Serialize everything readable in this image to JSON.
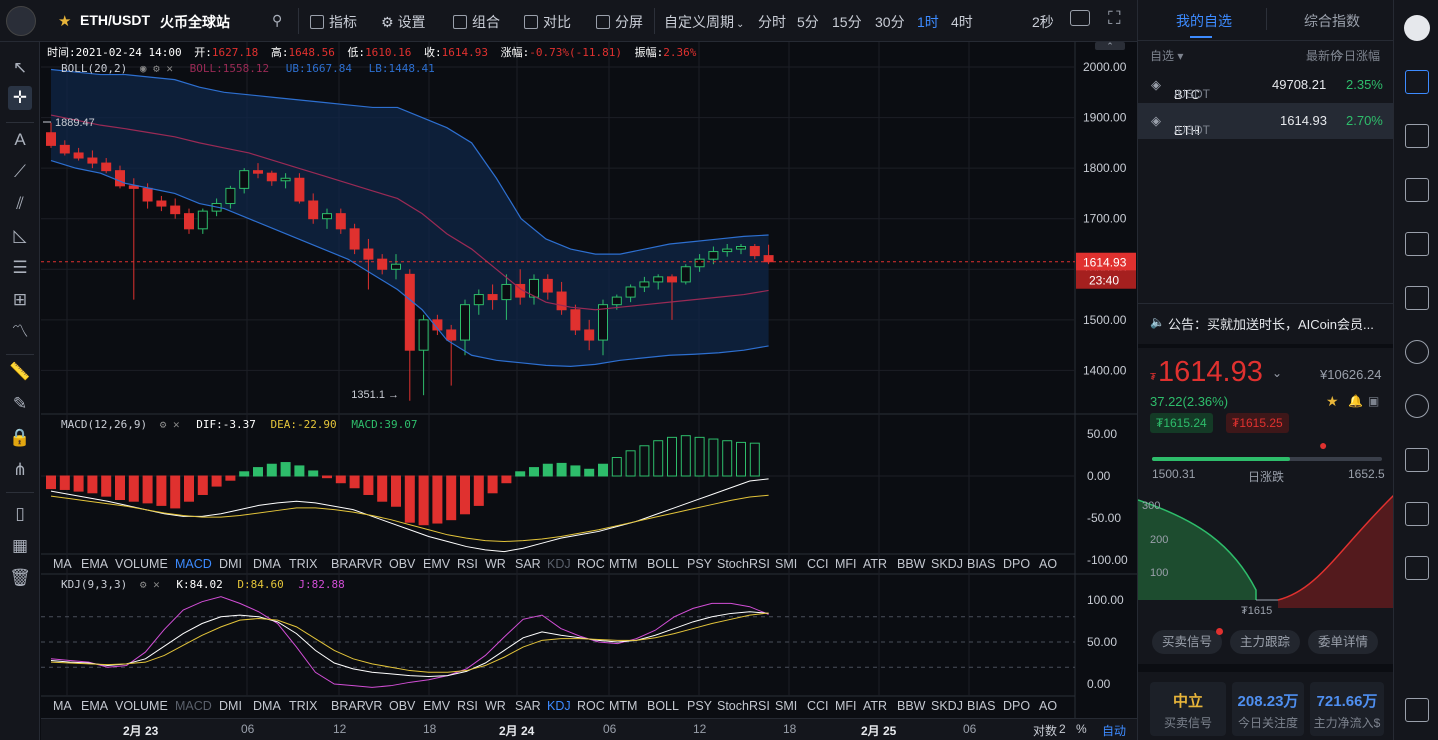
{
  "toolbar": {
    "pair": "ETH/USDT",
    "exchange": "火币全球站",
    "indicators": "指标",
    "settings": "设置",
    "combine": "组合",
    "compare": "对比",
    "split": "分屏",
    "custom_period": "自定义周期",
    "periods": [
      "分时",
      "5分",
      "15分",
      "30分",
      "1时",
      "4时"
    ],
    "active_period": "1时",
    "refresh": "2秒"
  },
  "ohlc": {
    "time_label": "时间:",
    "time": "2021-02-24 14:00",
    "open_label": "开:",
    "open": "1627.18",
    "high_label": "高:",
    "high": "1648.56",
    "low_label": "低:",
    "low": "1610.16",
    "close_label": "收:",
    "close": "1614.93",
    "change_label": "涨幅:",
    "change": "-0.73%(-11.81)",
    "amp_label": "振幅:",
    "amp": "2.36%"
  },
  "boll": {
    "name": "BOLL(20,2)",
    "mid": "BOLL:1558.12",
    "ub": "UB:1667.84",
    "lb": "LB:1448.41"
  },
  "macd": {
    "name": "MACD(12,26,9)",
    "dif": "DIF:-3.37",
    "dea": "DEA:-22.90",
    "macd": "MACD:39.07"
  },
  "kdj": {
    "name": "KDJ(9,3,3)",
    "k": "K:84.02",
    "d": "D:84.60",
    "j": "J:82.88"
  },
  "price_axis": [
    "2000.00",
    "1900.00",
    "1800.00",
    "1700.00",
    "1600.00",
    "1500.00",
    "1400.00"
  ],
  "current_price_tag": "1614.93",
  "countdown_tag": "23:40",
  "high_marker": "1889.47",
  "low_marker": "1351.1",
  "macd_axis": [
    "50.00",
    "0.00",
    "-50.00",
    "-100.00"
  ],
  "kdj_axis": [
    "100.00",
    "50.00",
    "0.00"
  ],
  "indicator_tabs": [
    "MA",
    "EMA",
    "VOLUME",
    "MACD",
    "DMI",
    "DMA",
    "TRIX",
    "BRAR",
    "VR",
    "OBV",
    "EMV",
    "RSI",
    "WR",
    "SAR",
    "KDJ",
    "ROC",
    "MTM",
    "BOLL",
    "PSY",
    "StochRSI",
    "SMI",
    "CCI",
    "MFI",
    "ATR",
    "BBW",
    "SKDJ",
    "BIAS",
    "DPO",
    "AO"
  ],
  "time_axis": [
    "2月 23",
    "06",
    "12",
    "18",
    "2月 24",
    "06",
    "12",
    "18",
    "2月 25",
    "06"
  ],
  "bottom": {
    "log": "对数",
    "count": "2",
    "percent": "%",
    "auto": "自动"
  },
  "right": {
    "tab_watchlist": "我的自选",
    "tab_index": "综合指数",
    "col_watch": "自选",
    "col_price": "最新价",
    "col_change": "今日涨幅",
    "rows": [
      {
        "base": "BTC",
        "quote": "/USDT",
        "price": "49708.21",
        "change": "2.35%"
      },
      {
        "base": "ETH",
        "quote": "/USDT",
        "price": "1614.93",
        "change": "2.70%"
      }
    ],
    "notice": "公告：买就加送时长，AICoin会员...",
    "price": "1614.93",
    "price_sym": "₮",
    "cny": "¥10626.24",
    "delta": "37.22(2.36%)",
    "bid": "₮1615.24",
    "ask": "₮1615.25",
    "range_low": "1500.31",
    "range_label": "日涨跌",
    "range_high": "1652.5",
    "range_fill": 0.6,
    "depth_300": "300",
    "depth_200": "200",
    "depth_100": "100",
    "depth_mid": "₮1615",
    "btn_signal": "买卖信号",
    "btn_main": "主力跟踪",
    "btn_order": "委单详情",
    "sentiment": "中立",
    "sentiment_label": "买卖信号",
    "attention": "208.23万",
    "attention_label": "今日关注度",
    "inflow": "721.66万",
    "inflow_label": "主力净流入$"
  },
  "colors": {
    "up": "#2ebd6b",
    "down": "#e0312f",
    "accent": "#3d8bff",
    "boll_band": "#0f2547"
  }
}
